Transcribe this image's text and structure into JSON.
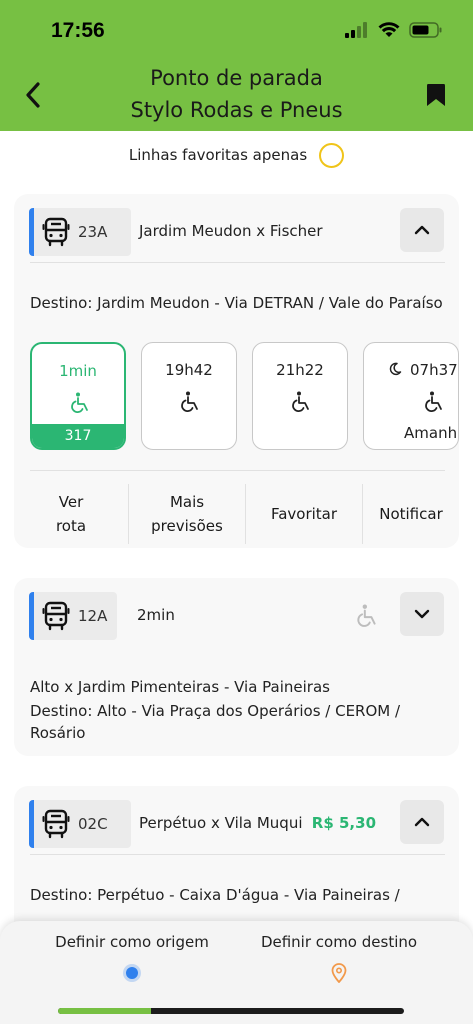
{
  "status_bar": {
    "time": "17:56"
  },
  "header": {
    "title_line1": "Ponto de parada",
    "title_line2": "Stylo Rodas e Pneus",
    "back_icon": "chevron-left-icon",
    "bookmark_icon": "bookmark-icon"
  },
  "filter": {
    "label": "Linhas favoritas apenas",
    "checked": false
  },
  "colors": {
    "brand_green": "#77c043",
    "accent_green": "#2bb673",
    "line_blue": "#2f80ed",
    "radio_yellow": "#f0c419",
    "origin_orange": "#f2994a"
  },
  "cards": [
    {
      "code": "23A",
      "name": "Jardim Meudon x Fischer",
      "expanded": true,
      "destination": "Destino: Jardim Meudon - Via DETRAN / Vale do Paraíso",
      "times": [
        {
          "time": "1min",
          "footer": "317",
          "accessible": true,
          "active": true
        },
        {
          "time": "19h42",
          "footer": "",
          "accessible": true,
          "active": false
        },
        {
          "time": "21h22",
          "footer": "",
          "accessible": true,
          "active": false
        },
        {
          "time": "07h37",
          "footer": "Amanhã",
          "accessible": true,
          "active": false,
          "night": true
        }
      ],
      "actions": [
        "Ver rota",
        "Mais previsões",
        "Favoritar",
        "Notificar"
      ]
    },
    {
      "code": "12A",
      "name": "2min",
      "expanded": false,
      "route": "Alto x Jardim Pimenteiras - Via Paineiras",
      "destination": "Destino: Alto - Via Praça dos Operários / CEROM / Rosário"
    },
    {
      "code": "02C",
      "name": "Perpétuo x Vila Muqui",
      "price": "R$ 5,30",
      "expanded": true,
      "destination": "Destino: Perpétuo - Caixa D'água  -  Via Paineiras /"
    }
  ],
  "bottom_sheet": {
    "origin_label": "Definir como origem",
    "destination_label": "Definir como destino"
  },
  "home_indicator": {
    "progress": 0.27
  }
}
